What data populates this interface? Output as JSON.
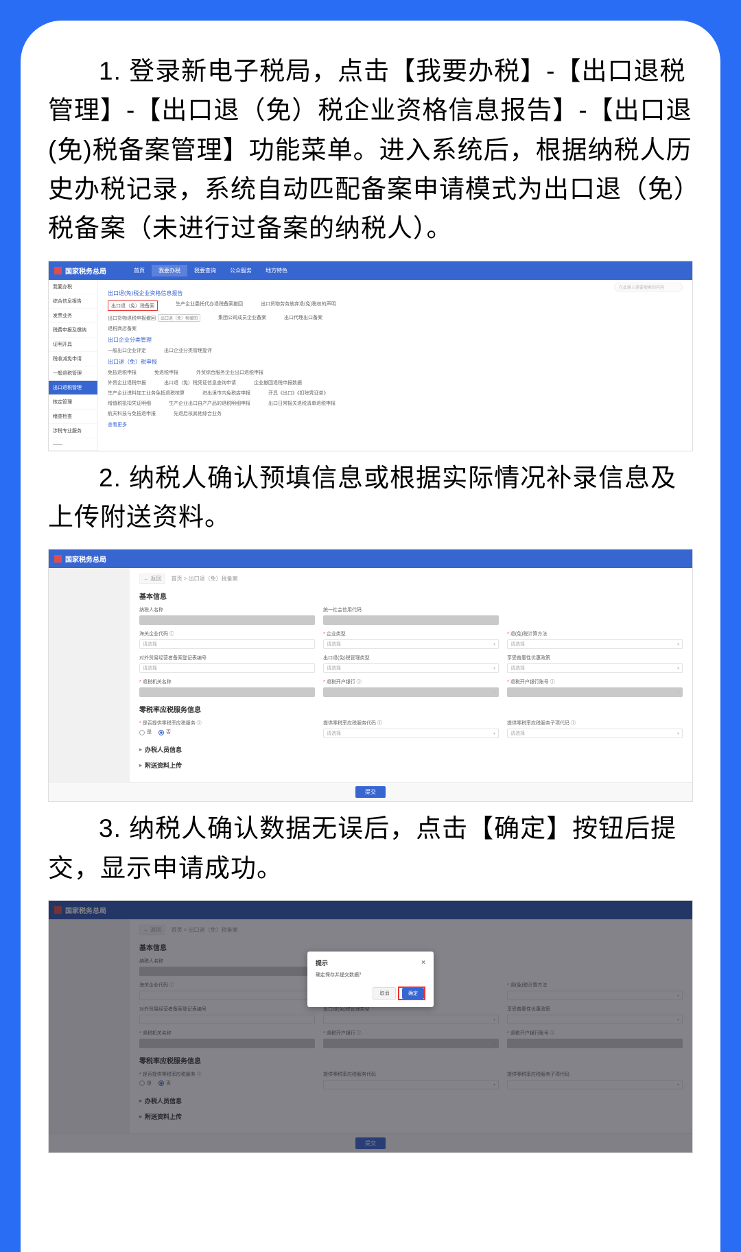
{
  "step1_text": "1. 登录新电子税局，点击【我要办税】-【出口退税管理】-【出口退（免）税企业资格信息报告】-【出口退(免)税备案管理】功能菜单。进入系统后，根据纳税人历史办税记录，系统自动匹配备案申请模式为出口退（免）税备案（未进行过备案的纳税人）。",
  "step2_text": "2. 纳税人确认预填信息或根据实际情况补录信息及上传附送资料。",
  "step3_text": "3. 纳税人确认数据无误后，点击【确定】按钮后提交，显示申请成功。",
  "gov_title": "国家税务总局",
  "gov_title_alt": "国家税务总局",
  "s1": {
    "tabs": [
      "首页",
      "我要办税",
      "我要查询",
      "公众服务",
      "地方特色"
    ],
    "search_placeholder": "在此输入需要搜索的内容",
    "sidebar": [
      "我要办税",
      "综合信息报告",
      "发票业务",
      "税费申报及缴纳",
      "证明开具",
      "税收减免申请",
      "一般退税管理",
      "出口退税管理",
      "核定管理",
      "稽查检查",
      "涉税专业服务",
      "——"
    ],
    "sec1_title": "出口退(免)税企业资格信息报告",
    "sec1_row1": [
      "出口退（免）税备案",
      "生产企业委托代办退税备案撤回",
      "出口货物劳务放弃退(免)税权的声明"
    ],
    "sec1_highlight": "出口退（免）税备案",
    "sec1_row2_left": "出口货物退税申报撤回",
    "sec1_badge": "出口退（免）税撤回",
    "sec1_row2_mid": "集团公司成员企业备案",
    "sec1_row2_right": "出口代理出口备案",
    "sec1_row3_left": "退税商店备案",
    "sec2_title": "出口企业分类管理",
    "sec2_row1_left": "一般出口企业评定",
    "sec2_row1_right": "出口企业分类管理复评",
    "sec3_title": "出口退（免）税申报",
    "sec3_rows": [
      [
        "免抵退税申报",
        "免退税申报",
        "外贸综合服务企业出口退税申报"
      ],
      [
        "外贸企业退税申报",
        "出口退（免）税凭证信息查询申请",
        "企业撤回退税申报数据"
      ],
      [
        "生产企业进料加工业务免抵退税核算",
        "进出境市内免税店申报",
        "开具《出口》《扣除凭证单》"
      ],
      [
        "增值税抵扣凭证明细",
        "生产企业出口自产产品的退税明细申报",
        "出口日常报关退税清单退税申报"
      ],
      [
        "航天科技与免抵退申报",
        "先退后核其他综合业务",
        "——"
      ]
    ],
    "more": "查看更多"
  },
  "s2": {
    "crumb_back": "返回",
    "crumb": "首页 > 出口退（免）税备案",
    "section1": "基本信息",
    "f_taxpayer": "纳税人名称",
    "f_code": "统一社会信用代码",
    "f_overseas": "海关企业代码",
    "f_type": "企业类型",
    "f_method": "退(免)税计算方法",
    "f_foreign": "对外贸易经营者备案登记表编号",
    "f_mgmtype": "出口退(免)税管理类型",
    "f_policy": "享受普惠性优惠政策",
    "f_taxauth": "退税机关名称",
    "f_bank": "退税开户银行",
    "f_account": "退税开户银行账号",
    "section2": "零税率应税服务信息",
    "f_zero": "是否提供零税率应税服务",
    "f_zerocode": "提供零税率应税服务代码",
    "f_zerosubcode": "提供零税率应税服务子项代码",
    "radio_yes": "是",
    "radio_no": "否",
    "collapse1": "办税人员信息",
    "collapse2": "附送资料上传",
    "submit_btn": "提交",
    "ph_select": "请选择"
  },
  "s3": {
    "crumb_back": "返回",
    "crumb": "首页 > 出口退（免）税备案",
    "section1": "基本信息",
    "modal_title": "提示",
    "modal_body": "确定保存并提交数据？",
    "btn_cancel": "取消",
    "btn_ok": "确定",
    "submit_btn": "提交"
  }
}
